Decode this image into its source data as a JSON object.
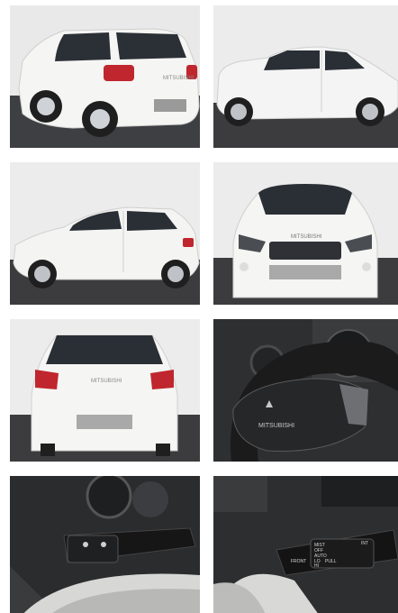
{
  "gallery": {
    "photos": [
      {
        "subject": "rear-three-quarter-view",
        "badge": "MITSUBISHI"
      },
      {
        "subject": "side-view-facing-right"
      },
      {
        "subject": "side-view-facing-left"
      },
      {
        "subject": "front-view",
        "badge": "MITSUBISHI"
      },
      {
        "subject": "rear-view",
        "badge": "MITSUBISHI"
      },
      {
        "subject": "steering-wheel",
        "badge": "MITSUBISHI"
      },
      {
        "subject": "light-switch-stalk"
      },
      {
        "subject": "wiper-switch-stalk",
        "labels": {
          "mist": "MIST",
          "off": "OFF",
          "auto": "AUTO",
          "lo": "LO",
          "hi": "HI",
          "pull": "PULL",
          "int": "INT",
          "front": "FRONT"
        }
      }
    ]
  },
  "colors": {
    "car_white": "#f4f4f2",
    "backdrop": "#e6e6e6",
    "ground": "#3c3c3e",
    "interior_dark": "#1d1d1f",
    "glass": "#2a2e35"
  }
}
